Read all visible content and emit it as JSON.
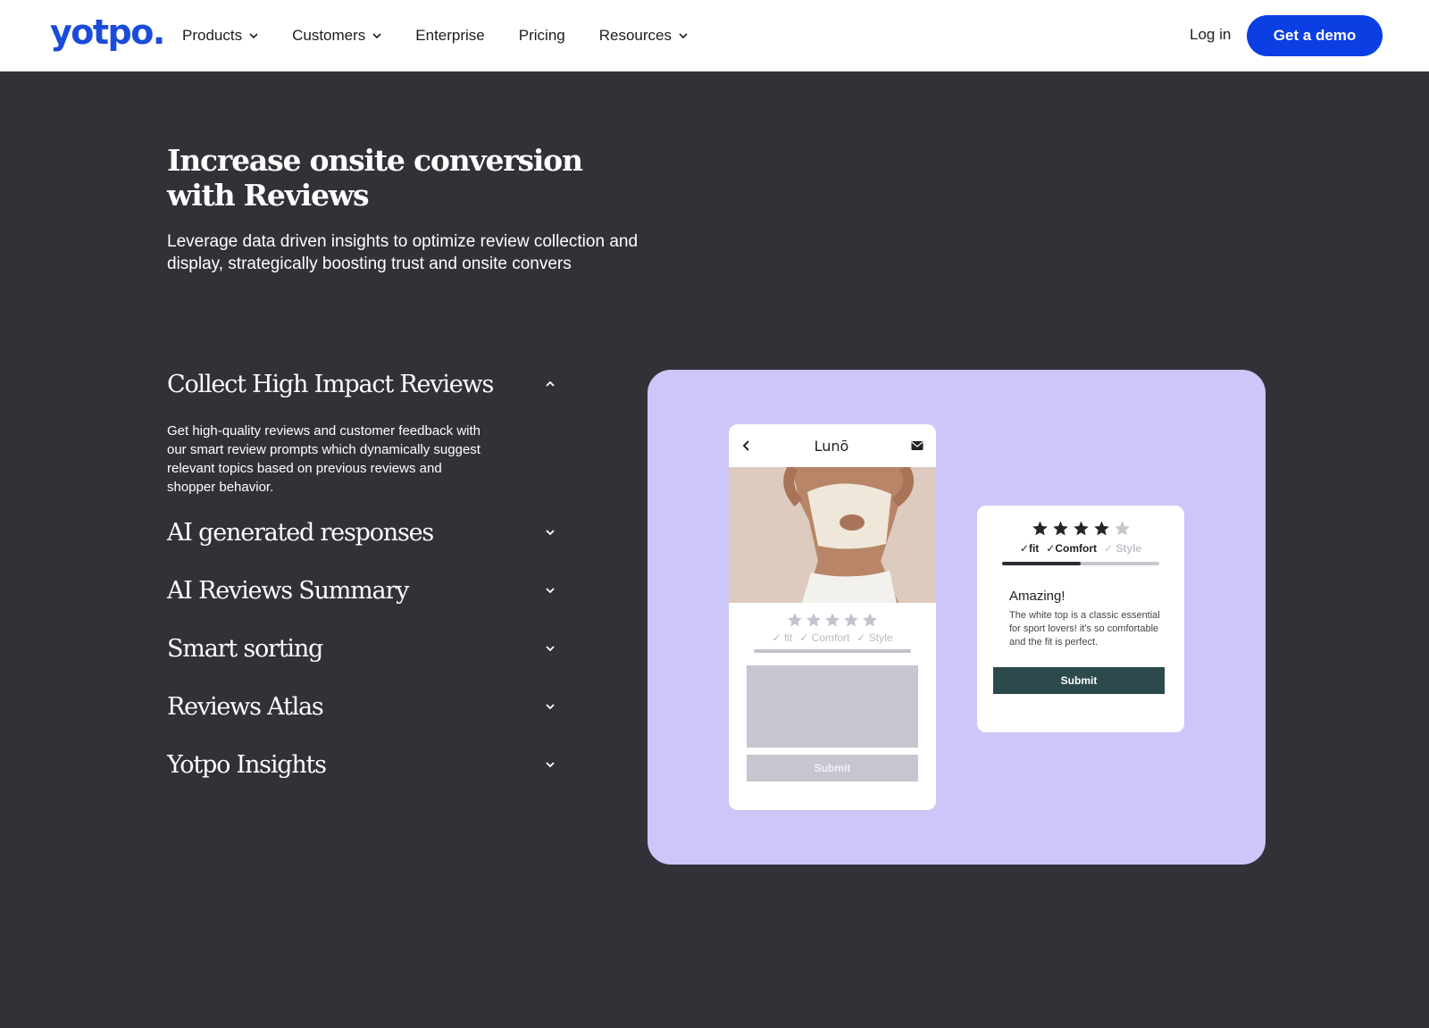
{
  "nav": {
    "logo": "yotpo.",
    "links": [
      {
        "label": "Products",
        "has_dropdown": true
      },
      {
        "label": "Customers",
        "has_dropdown": true
      },
      {
        "label": "Enterprise",
        "has_dropdown": false
      },
      {
        "label": "Pricing",
        "has_dropdown": false
      },
      {
        "label": "Resources",
        "has_dropdown": true
      }
    ],
    "login": "Log in",
    "cta": "Get a demo"
  },
  "hero": {
    "title": "Increase onsite conversion with Reviews",
    "subtitle": "Leverage data driven insights to optimize review collection and display, strategically boosting trust and onsite convers"
  },
  "features": [
    {
      "title": "Collect High Impact Reviews",
      "expanded": true,
      "body": "Get high-quality reviews and customer feedback with our smart review prompts which dynamically suggest relevant topics based on previous reviews and shopper behavior."
    },
    {
      "title": "AI generated responses",
      "expanded": false
    },
    {
      "title": "AI Reviews Summary",
      "expanded": false
    },
    {
      "title": "Smart sorting",
      "expanded": false
    },
    {
      "title": "Reviews Atlas",
      "expanded": false
    },
    {
      "title": "Yotpo Insights",
      "expanded": false
    }
  ],
  "illustration": {
    "phone": {
      "brand": "Lunō",
      "tags": [
        "fit",
        "Comfort",
        "Style"
      ],
      "submit": "Submit"
    },
    "card": {
      "rating": 4,
      "max_rating": 5,
      "tags": [
        "fit",
        "Comfort",
        "Style"
      ],
      "progress": 0.5,
      "heading": "Amazing!",
      "review": "The white top is a classic essential for sport lovers! it's so comfortable and the fit is perfect.",
      "submit": "Submit"
    }
  },
  "colors": {
    "background": "#303238",
    "accent": "#0b3ee3",
    "illustration_bg": "#cdc6f8",
    "submit_dark": "#2c4a4c"
  }
}
